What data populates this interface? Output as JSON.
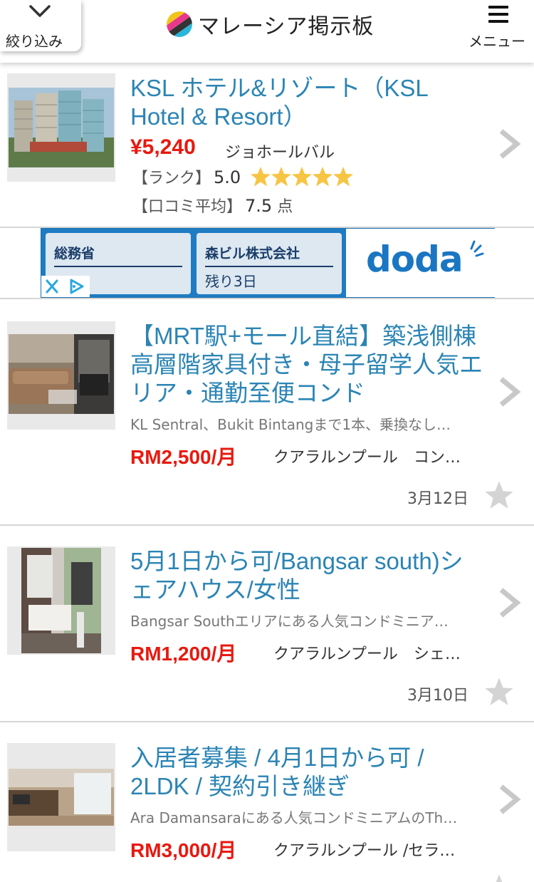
{
  "header": {
    "filter_label": "絞り込み",
    "site_title": "マレーシア掲示板",
    "menu_label": "メニュー"
  },
  "hotel": {
    "title": "KSL ホテル&リゾート（KSL Hotel & Resort）",
    "price": "¥5,240",
    "area": "ジョホールバル",
    "rank_label": "【ランク】",
    "rank_value": "5.0",
    "rank_stars": 5,
    "review_label": "【口コミ平均】",
    "review_value": "7.5",
    "review_unit": "点"
  },
  "ad": {
    "card1_head": "総務省",
    "card2_head": "森ビル株式会社",
    "card2_body": "残り3日",
    "brand": "doda"
  },
  "listings": [
    {
      "title": "【MRT駅+モール直結】築浅側棟高層階家具付き・母子留学人気エリア・通勤至便コンド",
      "sub": "KL Sentral、Bukit Bintangまで1本、乗換なし…",
      "price": "RM2,500/月",
      "loc": "クアラルンプール　コン…",
      "date": "3月12日"
    },
    {
      "title": "5月1日から可/Bangsar south)シェアハウス/女性",
      "sub": "Bangsar Southエリアにある人気コンドミニア…",
      "price": "RM1,200/月",
      "loc": "クアラルンプール　シェ…",
      "date": "3月10日"
    },
    {
      "title": "入居者募集 / 4月1日から可 / 2LDK / 契約引き継ぎ",
      "sub": "Ara Damansaraにある人気コンドミニアムのTh…",
      "price": "RM3,000/月",
      "loc": "クアラルンプール /セラ…",
      "date": ""
    }
  ],
  "colors": {
    "title_blue": "#2b84b4",
    "price_red": "#e8190f",
    "star_gold": "#f6c544",
    "ad_blue": "#1f7cc3"
  }
}
